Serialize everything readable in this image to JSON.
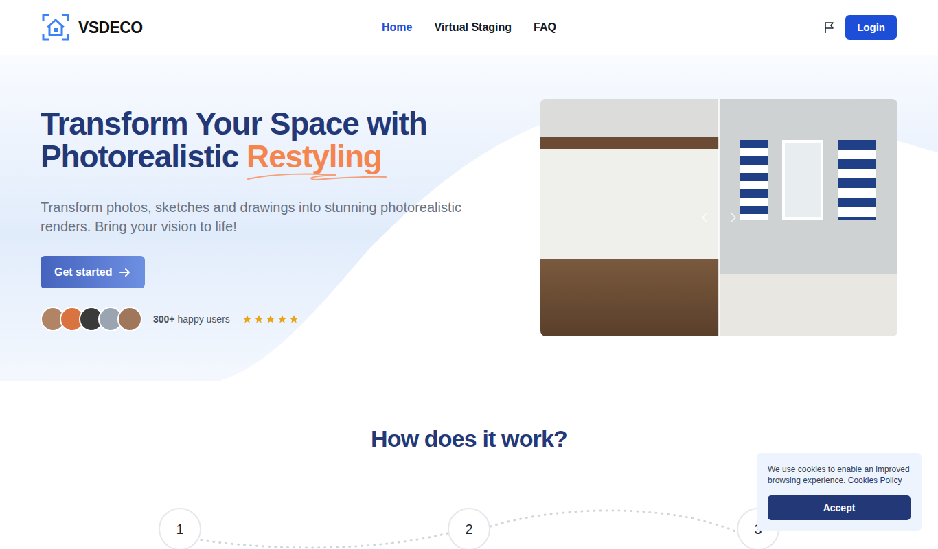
{
  "brand": {
    "name": "VSDECO"
  },
  "nav": {
    "items": [
      {
        "label": "Home",
        "selected": true
      },
      {
        "label": "Virtual Staging",
        "selected": false
      },
      {
        "label": "FAQ",
        "selected": false
      }
    ],
    "login": "Login"
  },
  "hero": {
    "title_line1": "Transform Your Space with",
    "title_line2": "Photorealistic",
    "title_highlight": "Restyling",
    "subtitle": "Transform photos, sketches and drawings into stunning photorealistic renders. Bring your vision to life!",
    "cta": "Get started",
    "users": {
      "count": "300+",
      "label": "happy users",
      "stars": 5
    },
    "comparison": {
      "level": 0.5
    }
  },
  "how": {
    "title": "How does it work?",
    "steps": [
      "1",
      "2",
      "3"
    ]
  },
  "cookie": {
    "text": "We use cookies to enable an improved browsing experience.",
    "link": "Cookies Policy",
    "button": "Accept"
  }
}
